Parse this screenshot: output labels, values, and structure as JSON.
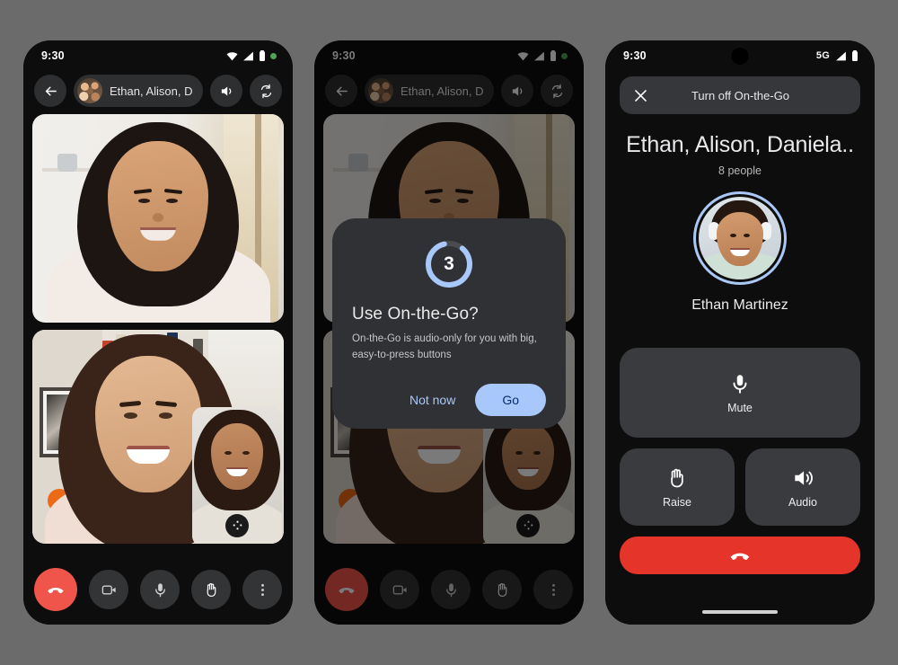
{
  "background_color": "#6b6b6b",
  "accent_blue": "#a8c7fa",
  "end_call_red": "#f0554b",
  "phone1": {
    "name": "video-call-screen",
    "status_bar": {
      "time": "9:30",
      "icons": [
        "wifi-icon",
        "cellular-signal-icon",
        "battery-icon",
        "recording-dot-icon"
      ]
    },
    "header": {
      "back_icon": "back-arrow-icon",
      "avatar": "group-avatar",
      "title": "Ethan, Alison, Dani...",
      "speaker_icon": "volume-up-icon",
      "flip_icon": "camera-switch-icon"
    },
    "tiles": [
      {
        "label": "remote-participant-tile"
      },
      {
        "label": "self-and-participant-tile"
      }
    ],
    "pip": {
      "badge_icon": "drag-handle-dots-icon"
    },
    "controls": [
      {
        "name": "end-call-button",
        "icon": "phone-hangup-icon",
        "style": "end"
      },
      {
        "name": "camera-toggle-button",
        "icon": "video-camera-icon",
        "style": "normal"
      },
      {
        "name": "microphone-toggle-button",
        "icon": "microphone-icon",
        "style": "normal"
      },
      {
        "name": "raise-hand-button",
        "icon": "raised-hand-icon",
        "style": "normal"
      },
      {
        "name": "more-options-button",
        "icon": "more-vertical-icon",
        "style": "normal"
      }
    ]
  },
  "phone2": {
    "name": "on-the-go-prompt-screen",
    "status_bar": {
      "time": "9:30",
      "icons": [
        "wifi-icon",
        "cellular-signal-icon",
        "battery-icon",
        "recording-dot-icon"
      ]
    },
    "header": {
      "back_icon": "back-arrow-icon",
      "avatar": "group-avatar",
      "title": "Ethan, Alison, Dani...",
      "speaker_icon": "volume-up-icon",
      "flip_icon": "camera-switch-icon"
    },
    "dialog": {
      "countdown": "3",
      "countdown_progress_percent": 85,
      "title": "Use On-the-Go?",
      "body": "On-the-Go is audio-only for you with big, easy-to-press buttons",
      "secondary_label": "Not now",
      "primary_label": "Go"
    },
    "controls": [
      {
        "name": "end-call-button",
        "icon": "phone-hangup-icon",
        "style": "end"
      },
      {
        "name": "camera-toggle-button",
        "icon": "video-camera-icon",
        "style": "normal"
      },
      {
        "name": "microphone-toggle-button",
        "icon": "microphone-icon",
        "style": "normal"
      },
      {
        "name": "raise-hand-button",
        "icon": "raised-hand-icon",
        "style": "normal"
      },
      {
        "name": "more-options-button",
        "icon": "more-vertical-icon",
        "style": "normal"
      }
    ]
  },
  "phone3": {
    "name": "on-the-go-active-screen",
    "status_bar": {
      "time": "9:30",
      "network": "5G",
      "icons": [
        "cellular-signal-icon",
        "battery-icon"
      ]
    },
    "turn_off_bar": {
      "close_icon": "close-x-icon",
      "label": "Turn off On-the-Go"
    },
    "call_title": "Ethan, Alison, Daniela..",
    "participant_count": "8 people",
    "speaker_name": "Ethan Martinez",
    "buttons": {
      "mute": {
        "label": "Mute",
        "icon": "microphone-icon"
      },
      "raise": {
        "label": "Raise",
        "icon": "raised-hand-icon"
      },
      "audio": {
        "label": "Audio",
        "icon": "volume-up-icon"
      },
      "end_call": {
        "icon": "phone-hangup-icon"
      }
    }
  }
}
